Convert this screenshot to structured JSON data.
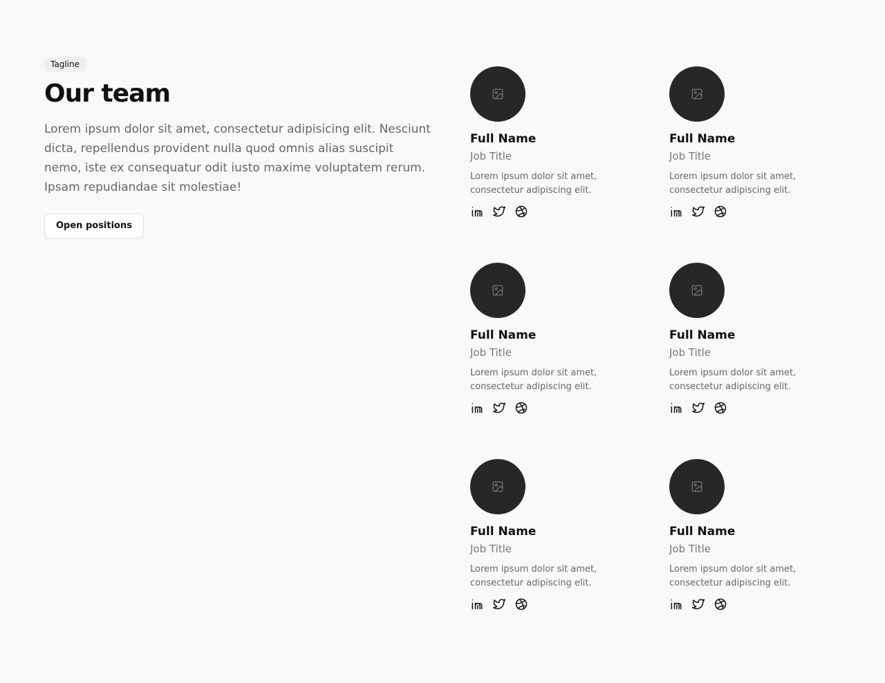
{
  "intro": {
    "tagline": "Tagline",
    "title": "Our team",
    "description": "Lorem ipsum dolor sit amet, consectetur adipisicing elit. Nesciunt dicta, repellendus provident nulla quod omnis alias suscipit nemo, iste ex consequatur odit iusto maxime voluptatem rerum. Ipsam repudiandae sit molestiae!",
    "button_label": "Open positions"
  },
  "members": [
    {
      "name": "Full Name",
      "job": "Job Title",
      "bio": "Lorem ipsum dolor sit amet, consectetur adipiscing elit.",
      "icons": [
        "image-placeholder-icon",
        "linkedin-icon",
        "twitter-icon",
        "dribbble-icon"
      ]
    },
    {
      "name": "Full Name",
      "job": "Job Title",
      "bio": "Lorem ipsum dolor sit amet, consectetur adipiscing elit.",
      "icons": [
        "image-placeholder-icon",
        "linkedin-icon",
        "twitter-icon",
        "dribbble-icon"
      ]
    },
    {
      "name": "Full Name",
      "job": "Job Title",
      "bio": "Lorem ipsum dolor sit amet, consectetur adipiscing elit.",
      "icons": [
        "image-placeholder-icon",
        "linkedin-icon",
        "twitter-icon",
        "dribbble-icon"
      ]
    },
    {
      "name": "Full Name",
      "job": "Job Title",
      "bio": "Lorem ipsum dolor sit amet, consectetur adipiscing elit.",
      "icons": [
        "image-placeholder-icon",
        "linkedin-icon",
        "twitter-icon",
        "dribbble-icon"
      ]
    },
    {
      "name": "Full Name",
      "job": "Job Title",
      "bio": "Lorem ipsum dolor sit amet, consectetur adipiscing elit.",
      "icons": [
        "image-placeholder-icon",
        "linkedin-icon",
        "twitter-icon",
        "dribbble-icon"
      ]
    },
    {
      "name": "Full Name",
      "job": "Job Title",
      "bio": "Lorem ipsum dolor sit amet, consectetur adipiscing elit.",
      "icons": [
        "image-placeholder-icon",
        "linkedin-icon",
        "twitter-icon",
        "dribbble-icon"
      ]
    }
  ],
  "colors": {
    "background": "#f9f9f9",
    "avatar": "#272727",
    "text": "#111111",
    "muted": "#666666"
  }
}
